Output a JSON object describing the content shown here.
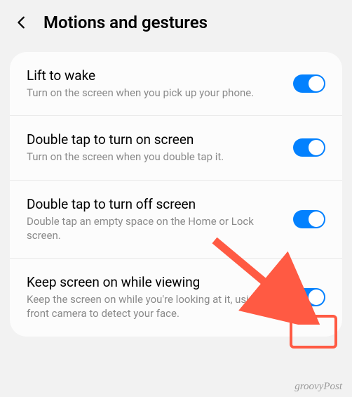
{
  "header": {
    "title": "Motions and gestures"
  },
  "settings": [
    {
      "title": "Lift to wake",
      "desc": "Turn on the screen when you pick up your phone.",
      "on": true
    },
    {
      "title": "Double tap to turn on screen",
      "desc": "Turn on the screen when you double tap it.",
      "on": true
    },
    {
      "title": "Double tap to turn off screen",
      "desc": "Double tap an empty space on the Home or Lock screen.",
      "on": true
    },
    {
      "title": "Keep screen on while viewing",
      "desc": "Keep the screen on while you're looking at it, using the front camera to detect your face.",
      "on": true
    }
  ],
  "watermark": "groovyPost"
}
